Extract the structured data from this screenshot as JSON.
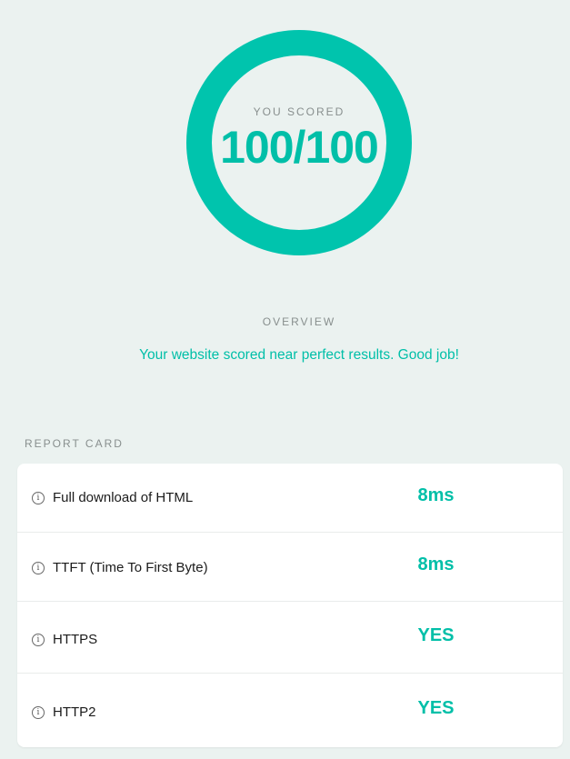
{
  "score": {
    "caption": "YOU SCORED",
    "value": "100/100",
    "fraction": 1.0,
    "ring_color": "#00c4ad"
  },
  "overview": {
    "heading": "OVERVIEW",
    "message": "Your website scored near perfect results. Good job!"
  },
  "report_card": {
    "heading": "REPORT CARD",
    "rows": [
      {
        "label": "Full download of HTML",
        "value": "8ms",
        "icon": "info-icon"
      },
      {
        "label": "TTFT (Time To First Byte)",
        "value": "8ms",
        "icon": "info-icon"
      },
      {
        "label": "HTTPS",
        "value": "YES",
        "icon": "info-icon"
      },
      {
        "label": "HTTP2",
        "value": "YES",
        "icon": "info-icon"
      }
    ]
  },
  "colors": {
    "accent": "#00bfa8",
    "background": "#ebf2f0",
    "muted_text": "#888f8e"
  }
}
